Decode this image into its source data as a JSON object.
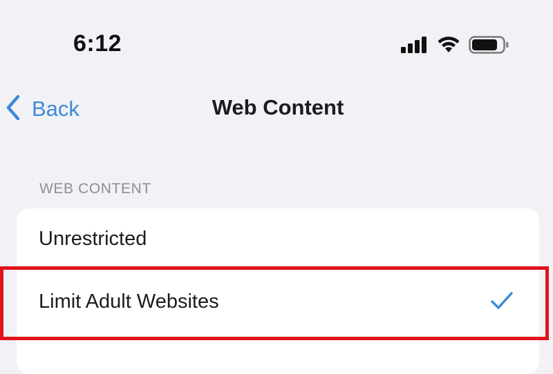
{
  "status_bar": {
    "time": "6:12",
    "icons": [
      "cellular-signal-icon",
      "wifi-icon",
      "battery-icon"
    ]
  },
  "nav": {
    "back_label": "Back",
    "title": "Web Content"
  },
  "section": {
    "header": "WEB CONTENT",
    "options": [
      {
        "label": "Unrestricted",
        "selected": false
      },
      {
        "label": "Limit Adult Websites",
        "selected": true
      }
    ]
  },
  "colors": {
    "accent": "#3d8ad8",
    "background": "#f1f1f6",
    "highlight": "#e0121b"
  }
}
